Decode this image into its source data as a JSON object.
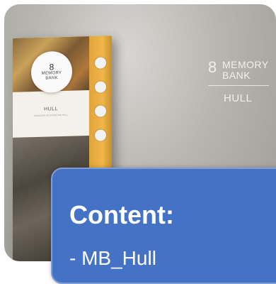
{
  "booklet": {
    "logo_mark": "8",
    "logo_word1": "MEMORY",
    "logo_word2": "BANK",
    "title": "HULL",
    "subtitle": "DISCOVER ROTATION FOR HULL",
    "spine_icons": [
      "book-icon",
      "pen-icon",
      "calendar-icon",
      "people-icon"
    ]
  },
  "logo": {
    "mark": "8",
    "word1": "MEMORY",
    "word2": "BANK",
    "city": "HULL"
  },
  "content": {
    "title": "Content:",
    "item": "- MB_Hull"
  },
  "colors": {
    "content_bg": "#4472c4",
    "spine": "#f0b648",
    "logo_text": "#f2f0ea"
  }
}
